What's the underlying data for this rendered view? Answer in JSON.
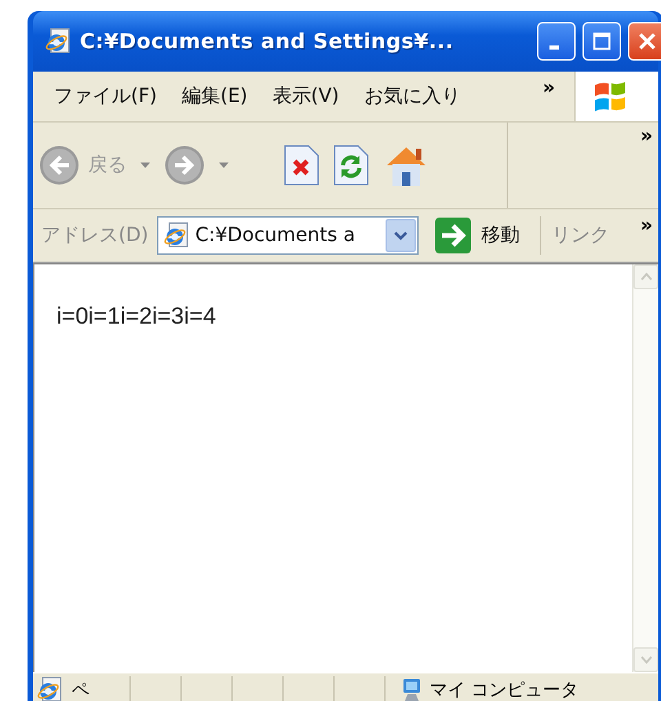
{
  "window": {
    "title": "C:¥Documents and Settings¥..."
  },
  "menu": {
    "items": [
      "ファイル(F)",
      "編集(E)",
      "表示(V)",
      "お気に入り"
    ],
    "overflow": "»"
  },
  "toolbar": {
    "back": {
      "label": "戻る",
      "disabled": true
    },
    "forward": {
      "disabled": true
    },
    "overflow": "»"
  },
  "address_bar": {
    "label": "アドレス(D)",
    "value": "C:¥Documents a",
    "go_label": "移動",
    "links_label": "リンク",
    "overflow": "»"
  },
  "content": {
    "text": "i=0i=1i=2i=3i=4"
  },
  "status_bar": {
    "text": "ペ",
    "zone": "マイ コンピュータ"
  }
}
